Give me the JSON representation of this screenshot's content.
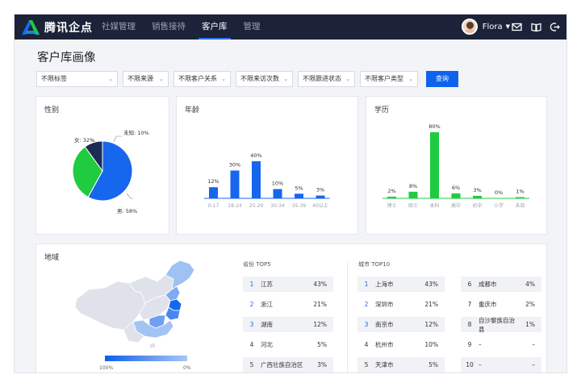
{
  "header": {
    "logo_text": "腾讯企点",
    "nav": [
      "社媒管理",
      "销售接待",
      "客户库",
      "管理"
    ],
    "active_nav": "客户库",
    "user_name": "Flora",
    "icons": [
      "mail-icon",
      "book-icon",
      "logout-icon"
    ]
  },
  "page": {
    "title": "客户库画像"
  },
  "filters": {
    "selects": [
      "不限标签",
      "不限来源",
      "不限客户关系",
      "不限来访次数",
      "不限跟进状态",
      "不限客户类型"
    ],
    "query_button": "查询"
  },
  "gender": {
    "title": "性别",
    "slices": [
      {
        "label": "男",
        "value": 58,
        "text": "男: 58%",
        "color": "#1766ee"
      },
      {
        "label": "女",
        "value": 32,
        "text": "女: 32%",
        "color": "#1fcb3f"
      },
      {
        "label": "未知",
        "value": 10,
        "text": "未知: 10%",
        "color": "#1d2b54"
      }
    ]
  },
  "age": {
    "title": "年龄",
    "categories": [
      "0-17",
      "18-24",
      "25-29",
      "30-34",
      "35-39",
      "40以上"
    ],
    "values": [
      12,
      30,
      40,
      10,
      5,
      3
    ],
    "labels": [
      "12%",
      "30%",
      "40%",
      "10%",
      "5%",
      "3%"
    ],
    "color": "#1766ee"
  },
  "education": {
    "title": "学历",
    "categories": [
      "博士",
      "硕士",
      "本科",
      "高中",
      "初中",
      "小学",
      "未知"
    ],
    "values": [
      2,
      8,
      80,
      6,
      3,
      0,
      1
    ],
    "labels": [
      "2%",
      "8%",
      "80%",
      "6%",
      "3%",
      "0%",
      "1%"
    ],
    "color": "#1fcb3f"
  },
  "region": {
    "title": "地域",
    "legend_max": "100%",
    "legend_min": "0%",
    "province_title": "省份 TOP5",
    "provinces": [
      {
        "rank": "1",
        "name": "江苏",
        "value": "43%"
      },
      {
        "rank": "2",
        "name": "浙江",
        "value": "21%"
      },
      {
        "rank": "3",
        "name": "湖南",
        "value": "12%"
      },
      {
        "rank": "4",
        "name": "河北",
        "value": "5%"
      },
      {
        "rank": "5",
        "name": "广西壮族自治区",
        "value": "3%"
      }
    ],
    "city_title": "城市 TOP10",
    "cities_left": [
      {
        "rank": "1",
        "name": "上海市",
        "value": "43%"
      },
      {
        "rank": "2",
        "name": "深圳市",
        "value": "21%"
      },
      {
        "rank": "3",
        "name": "南京市",
        "value": "12%"
      },
      {
        "rank": "4",
        "name": "杭州市",
        "value": "10%"
      },
      {
        "rank": "5",
        "name": "天津市",
        "value": "5%"
      }
    ],
    "cities_right": [
      {
        "rank": "6",
        "name": "成都市",
        "value": "4%"
      },
      {
        "rank": "7",
        "name": "重庆市",
        "value": "2%"
      },
      {
        "rank": "8",
        "name": "自沙黎族自治县",
        "value": "1%"
      },
      {
        "rank": "9",
        "name": "–",
        "value": "–"
      },
      {
        "rank": "10",
        "name": "–",
        "value": "–"
      }
    ]
  },
  "chart_data": [
    {
      "type": "pie",
      "title": "性别",
      "categories": [
        "男",
        "女",
        "未知"
      ],
      "values": [
        58,
        32,
        10
      ]
    },
    {
      "type": "bar",
      "title": "年龄",
      "categories": [
        "0-17",
        "18-24",
        "25-29",
        "30-34",
        "35-39",
        "40以上"
      ],
      "values": [
        12,
        30,
        40,
        10,
        5,
        3
      ]
    },
    {
      "type": "bar",
      "title": "学历",
      "categories": [
        "博士",
        "硕士",
        "本科",
        "高中",
        "初中",
        "小学",
        "未知"
      ],
      "values": [
        2,
        8,
        80,
        6,
        3,
        0,
        1
      ]
    }
  ]
}
